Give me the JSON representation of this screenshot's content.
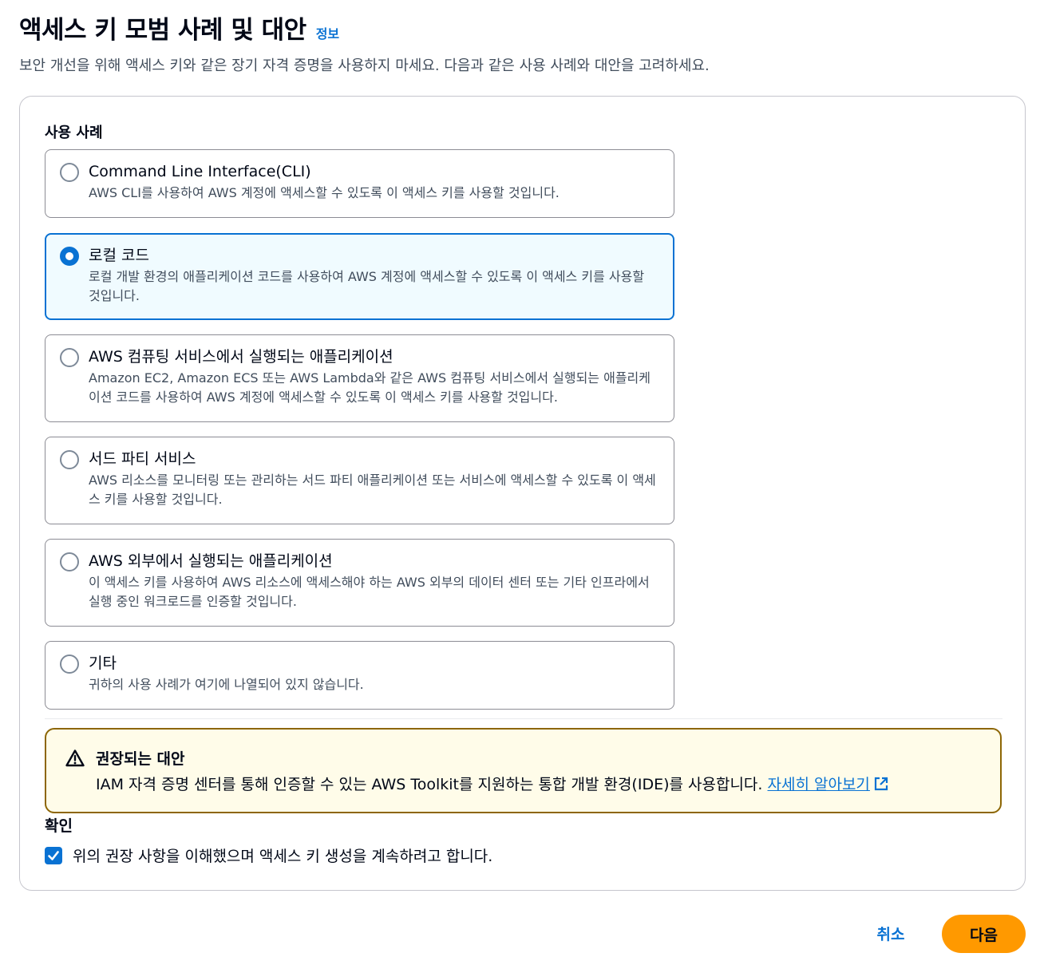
{
  "header": {
    "title": "액세스 키 모범 사례 및 대안",
    "info_link": "정보",
    "description": "보안 개선을 위해 액세스 키와 같은 장기 자격 증명을 사용하지 마세요. 다음과 같은 사용 사례와 대안을 고려하세요."
  },
  "use_cases": {
    "label": "사용 사례",
    "selected": "local-code",
    "options": [
      {
        "id": "cli",
        "title": "Command Line Interface(CLI)",
        "description": "AWS CLI를 사용하여 AWS 계정에 액세스할 수 있도록 이 액세스 키를 사용할 것입니다."
      },
      {
        "id": "local-code",
        "title": "로컬 코드",
        "description": "로컬 개발 환경의 애플리케이션 코드를 사용하여 AWS 계정에 액세스할 수 있도록 이 액세스 키를 사용할 것입니다."
      },
      {
        "id": "aws-compute",
        "title": "AWS 컴퓨팅 서비스에서 실행되는 애플리케이션",
        "description": "Amazon EC2, Amazon ECS 또는 AWS Lambda와 같은 AWS 컴퓨팅 서비스에서 실행되는 애플리케이션 코드를 사용하여 AWS 계정에 액세스할 수 있도록 이 액세스 키를 사용할 것입니다."
      },
      {
        "id": "third-party",
        "title": "서드 파티 서비스",
        "description": "AWS 리소스를 모니터링 또는 관리하는 서드 파티 애플리케이션 또는 서비스에 액세스할 수 있도록 이 액세스 키를 사용할 것입니다."
      },
      {
        "id": "outside-aws",
        "title": "AWS 외부에서 실행되는 애플리케이션",
        "description": "이 액세스 키를 사용하여 AWS 리소스에 액세스해야 하는 AWS 외부의 데이터 센터 또는 기타 인프라에서 실행 중인 워크로드를 인증할 것입니다."
      },
      {
        "id": "other",
        "title": "기타",
        "description": "귀하의 사용 사례가 여기에 나열되어 있지 않습니다."
      }
    ]
  },
  "alert": {
    "title": "권장되는 대안",
    "body": "IAM 자격 증명 센터를 통해 인증할 수 있는 AWS Toolkit를 지원하는 통합 개발 환경(IDE)를 사용합니다.",
    "link": "자세히 알아보기"
  },
  "confirmation": {
    "label": "확인",
    "checkbox_label": "위의 권장 사항을 이해했으며 액세스 키 생성을 계속하려고 합니다.",
    "checked": true
  },
  "footer": {
    "cancel": "취소",
    "next": "다음"
  },
  "colors": {
    "accent": "#0972d3",
    "primary_button": "#ff9900",
    "warning_border": "#8d6605",
    "warning_background": "#fffce9",
    "selected_tile_background": "#f0fbff"
  }
}
